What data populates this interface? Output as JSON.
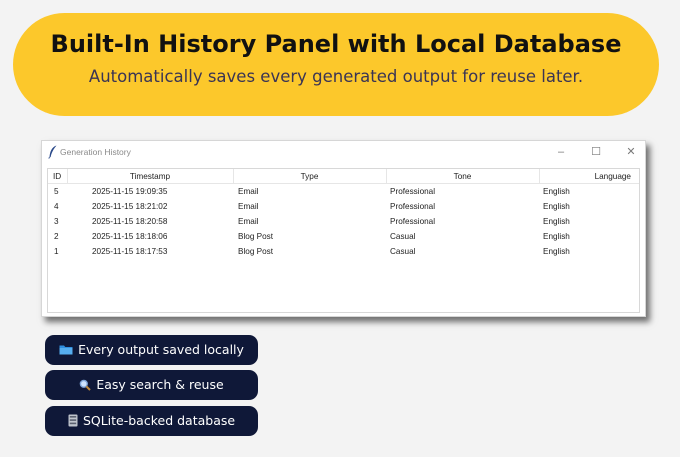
{
  "banner": {
    "title": "Built-In History Panel with Local Database",
    "subtitle": "Automatically saves every generated output for reuse later."
  },
  "window": {
    "title": "Generation History",
    "controls": {
      "minimize": "–",
      "maximize": "☐",
      "close": "✕"
    },
    "table": {
      "columns": [
        "ID",
        "Timestamp",
        "Type",
        "Tone",
        "Language"
      ],
      "rows": [
        {
          "id": "5",
          "timestamp": "2025-11-15 19:09:35",
          "type": "Email",
          "tone": "Professional",
          "language": "English"
        },
        {
          "id": "4",
          "timestamp": "2025-11-15 18:21:02",
          "type": "Email",
          "tone": "Professional",
          "language": "English"
        },
        {
          "id": "3",
          "timestamp": "2025-11-15 18:20:58",
          "type": "Email",
          "tone": "Professional",
          "language": "English"
        },
        {
          "id": "2",
          "timestamp": "2025-11-15 18:18:06",
          "type": "Blog Post",
          "tone": "Casual",
          "language": "English"
        },
        {
          "id": "1",
          "timestamp": "2025-11-15 18:17:53",
          "type": "Blog Post",
          "tone": "Casual",
          "language": "English"
        }
      ]
    }
  },
  "features": [
    {
      "icon": "folder-icon",
      "label": "Every output saved locally"
    },
    {
      "icon": "magnifier-icon",
      "label": "Easy search & reuse"
    },
    {
      "icon": "database-icon",
      "label": "SQLite-backed database"
    }
  ],
  "colors": {
    "banner_bg": "#fcc82b",
    "pill_bg": "#0f1838",
    "page_bg": "#f3f3f3"
  }
}
